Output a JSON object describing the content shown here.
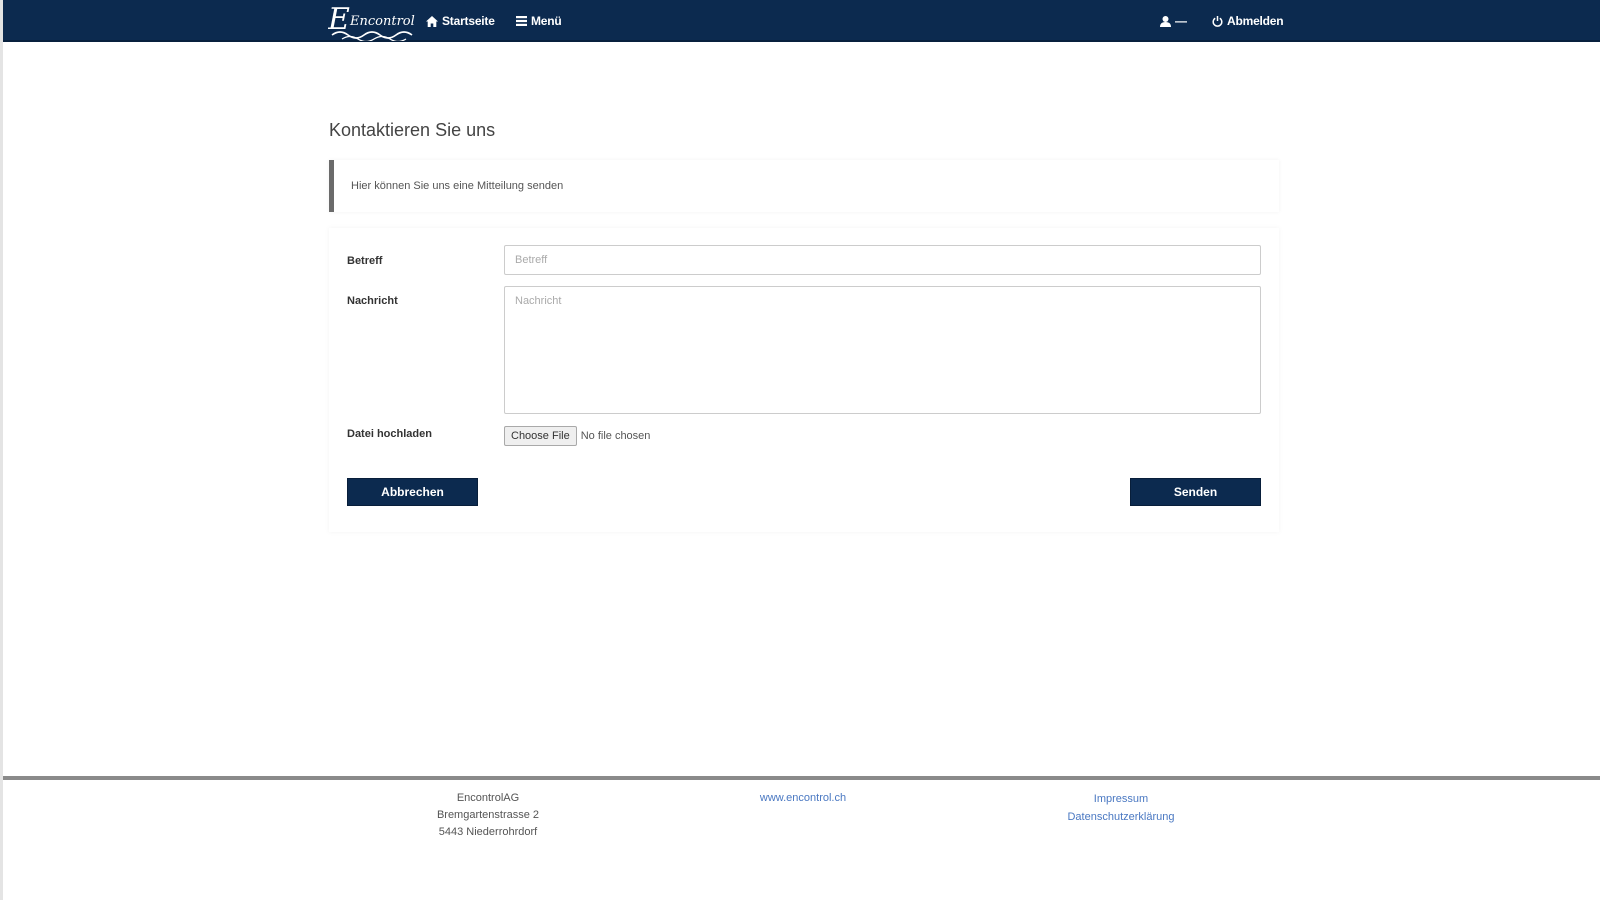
{
  "navbar": {
    "logo_text": "Encontrol",
    "home_label": "Startseite",
    "menu_label": "Menü",
    "user_label": "—",
    "logout_label": "Abmelden"
  },
  "main": {
    "title": "Kontaktieren Sie uns",
    "info_text": "Hier können Sie uns eine Mitteilung senden"
  },
  "form": {
    "subject_label": "Betreff",
    "subject_placeholder": "Betreff",
    "subject_value": "",
    "message_label": "Nachricht",
    "message_placeholder": "Nachricht",
    "message_value": "",
    "upload_label": "Datei hochladen",
    "file_button_label": "Choose File",
    "file_status": "No file chosen",
    "cancel_label": "Abbrechen",
    "send_label": "Senden"
  },
  "footer": {
    "company": "EncontrolAG",
    "street": "Bremgartenstrasse 2",
    "city": "5443 Niederrohrdorf",
    "website": "www.encontrol.ch",
    "imprint": "Impressum",
    "privacy": "Datenschutzerklärung"
  },
  "colors": {
    "navbar": "#0c2a4f",
    "button": "#0c2a4f",
    "link": "#4a78c2"
  }
}
